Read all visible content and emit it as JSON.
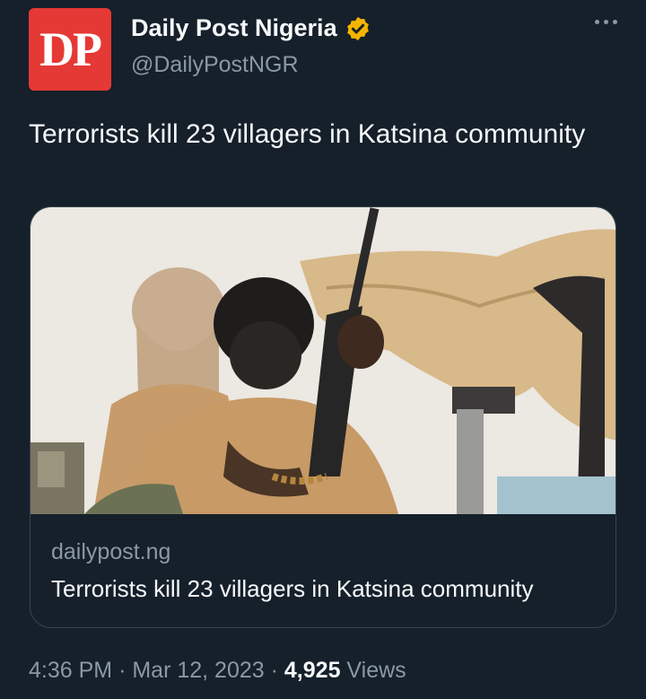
{
  "author": {
    "logo_text": "DP",
    "display_name": "Daily Post Nigeria",
    "handle": "@DailyPostNGR",
    "verified": true,
    "verified_color": "#f4b400",
    "logo_color": "#e53935"
  },
  "tweet": {
    "text": "Terrorists kill 23 villagers in Katsina community"
  },
  "card": {
    "image_icon": "photo-armed-men",
    "domain": "dailypost.ng",
    "title": "Terrorists kill 23 villagers in Katsina community"
  },
  "meta": {
    "time": "4:36 PM",
    "separator": "·",
    "date": "Mar 12, 2023",
    "views_count": "4,925",
    "views_label": "Views"
  },
  "colors": {
    "background": "#15202b",
    "text_primary": "#f7f9f9",
    "text_secondary": "#8b98a5",
    "border": "#38444d"
  }
}
